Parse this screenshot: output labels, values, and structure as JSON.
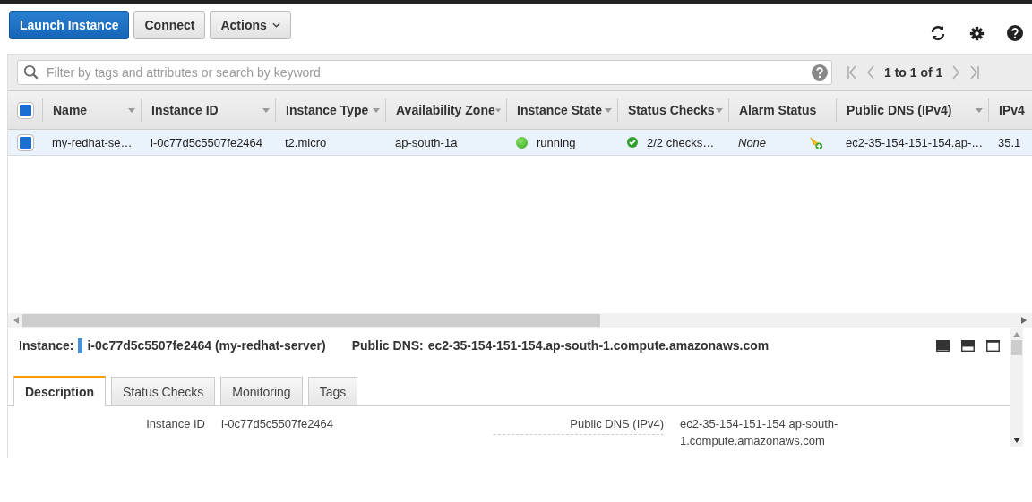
{
  "toolbar": {
    "buttons": [
      {
        "label": "Launch Instance",
        "kind": "primary"
      },
      {
        "label": "Connect",
        "kind": "plain"
      },
      {
        "label": "Actions",
        "kind": "dropdown"
      }
    ]
  },
  "filter": {
    "placeholder": "Filter by tags and attributes or search by keyword",
    "pagination": "1 to 1 of 1"
  },
  "table": {
    "all_selected": true,
    "columns": [
      {
        "label": "Name",
        "sortable": true
      },
      {
        "label": "Instance ID",
        "sortable": true
      },
      {
        "label": "Instance Type",
        "sortable": true
      },
      {
        "label": "Availability Zone",
        "sortable": true
      },
      {
        "label": "Instance State",
        "sortable": true
      },
      {
        "label": "Status Checks",
        "sortable": true
      },
      {
        "label": "Alarm Status",
        "sortable": false
      },
      {
        "label": "Public DNS (IPv4)",
        "sortable": true
      },
      {
        "label": "IPv4",
        "sortable": false
      }
    ],
    "rows": [
      {
        "selected": true,
        "name": "my-redhat-se…",
        "instance_id": "i-0c77d5c5507fe2464",
        "instance_type": "t2.micro",
        "zone": "ap-south-1a",
        "state": "running",
        "status_checks": "2/2 checks…",
        "alarm_status": "None",
        "public_dns": "ec2-35-154-151-154.ap-…",
        "ipv4": "35.1"
      }
    ]
  },
  "details": {
    "instance_label": "Instance:",
    "instance_value": "i-0c77d5c5507fe2464 (my-redhat-server)",
    "dns_label": "Public DNS:",
    "dns_value": "ec2-35-154-151-154.ap-south-1.compute.amazonaws.com",
    "tabs": [
      {
        "label": "Description",
        "selected": true
      },
      {
        "label": "Status Checks",
        "selected": false
      },
      {
        "label": "Monitoring",
        "selected": false
      },
      {
        "label": "Tags",
        "selected": false
      }
    ],
    "fields": [
      {
        "label": "Instance ID",
        "value": "i-0c77d5c5507fe2464"
      },
      {
        "label": "Public DNS (IPv4)",
        "value": "ec2-35-154-151-154.ap-south-1.compute.amazonaws.com"
      }
    ]
  }
}
